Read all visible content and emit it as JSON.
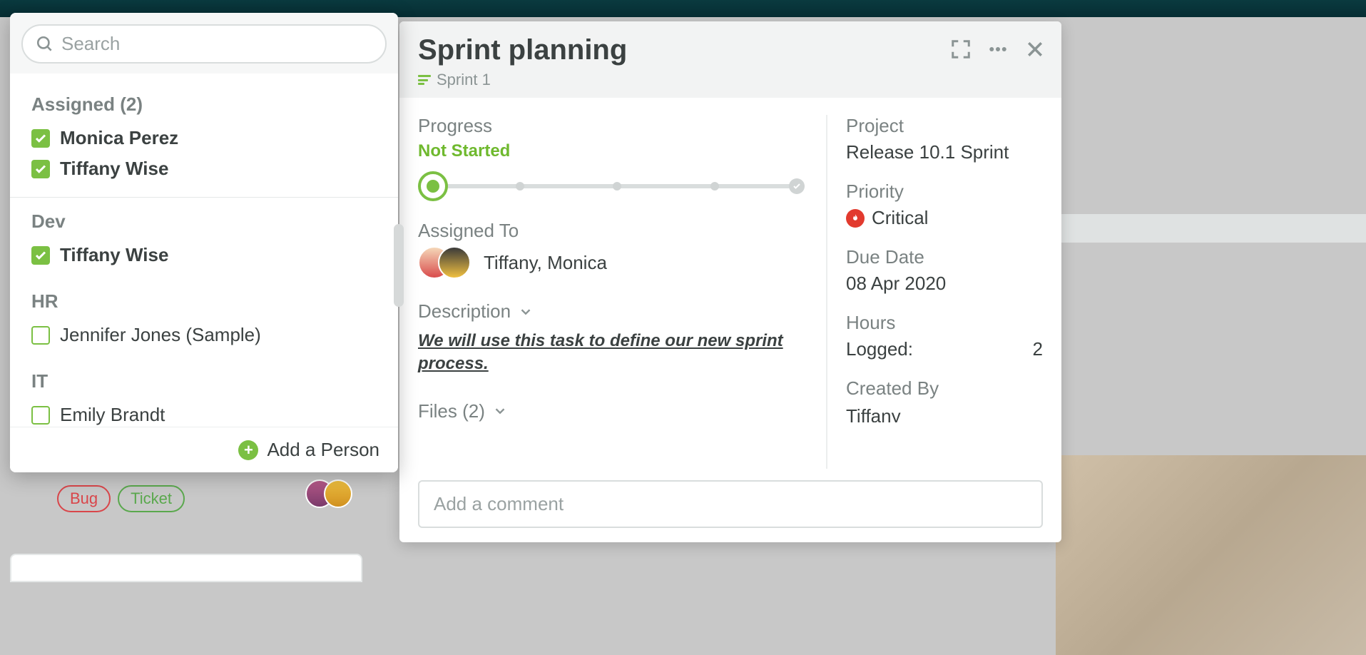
{
  "search": {
    "placeholder": "Search"
  },
  "assigned_header": "Assigned (2)",
  "groups": [
    {
      "name": "Dev",
      "people": [
        {
          "name": "Tiffany Wise",
          "checked": true
        }
      ]
    },
    {
      "name": "HR",
      "people": [
        {
          "name": "Jennifer Jones (Sample)",
          "checked": false
        }
      ]
    },
    {
      "name": "IT",
      "people": [
        {
          "name": "Emily Brandt",
          "checked": false
        }
      ]
    }
  ],
  "assigned_people": [
    {
      "name": "Monica Perez",
      "checked": true
    },
    {
      "name": "Tiffany Wise",
      "checked": true
    }
  ],
  "add_person_label": "Add a Person",
  "task": {
    "title": "Sprint planning",
    "breadcrumb": "Sprint 1",
    "progress_label": "Progress",
    "progress_status": "Not Started",
    "assigned_label": "Assigned To",
    "assigned_names": "Tiffany, Monica",
    "description_label": "Description",
    "description_text": "We will use this task to define our new sprint process. ",
    "files_label": "Files (2)",
    "comment_placeholder": "Add a comment"
  },
  "side": {
    "project_label": "Project",
    "project_value": "Release 10.1 Sprint",
    "priority_label": "Priority",
    "priority_value": "Critical",
    "due_label": "Due Date",
    "due_value": "08 Apr 2020",
    "hours_label": "Hours",
    "logged_label": "Logged:",
    "logged_value": "2",
    "createdby_label": "Created By",
    "createdby_value": "Tiffany"
  },
  "bg_tags": {
    "bug": "Bug",
    "ticket": "Ticket"
  }
}
